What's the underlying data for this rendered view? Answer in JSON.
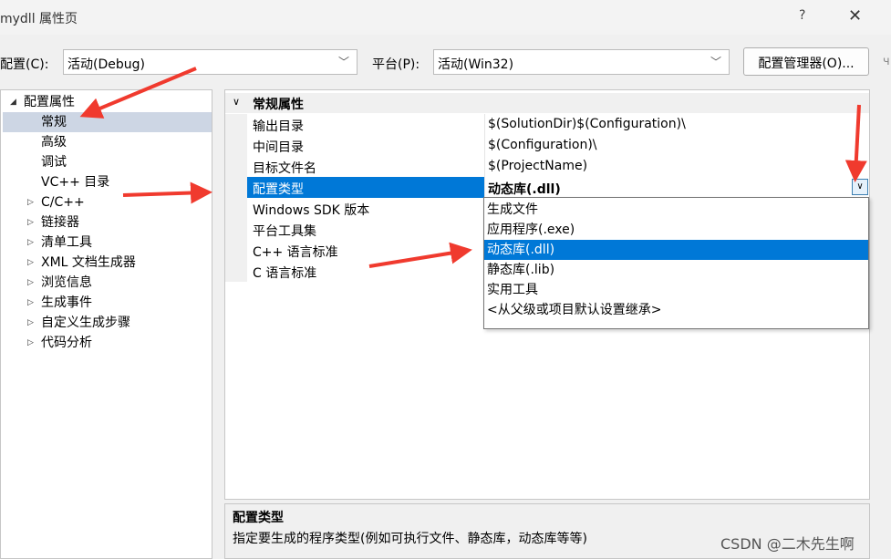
{
  "window": {
    "title": "mydll 属性页",
    "help_label": "?",
    "close_label": "✕",
    "edge_char": "ч"
  },
  "toolbar": {
    "config_label": "配置(C):",
    "config_value": "活动(Debug)",
    "platform_label": "平台(P):",
    "platform_value": "活动(Win32)",
    "manager_button": "配置管理器(O)..."
  },
  "tree": {
    "items": [
      {
        "label": "配置属性",
        "expander": "◢"
      },
      {
        "label": "常规",
        "expander": ""
      },
      {
        "label": "高级",
        "expander": ""
      },
      {
        "label": "调试",
        "expander": ""
      },
      {
        "label": "VC++ 目录",
        "expander": ""
      },
      {
        "label": "C/C++",
        "expander": "▷"
      },
      {
        "label": "链接器",
        "expander": "▷"
      },
      {
        "label": "清单工具",
        "expander": "▷"
      },
      {
        "label": "XML 文档生成器",
        "expander": "▷"
      },
      {
        "label": "浏览信息",
        "expander": "▷"
      },
      {
        "label": "生成事件",
        "expander": "▷"
      },
      {
        "label": "自定义生成步骤",
        "expander": "▷"
      },
      {
        "label": "代码分析",
        "expander": "▷"
      }
    ]
  },
  "grid": {
    "category": "常规属性",
    "category_expander": "∨",
    "rows": [
      {
        "name": "输出目录",
        "value": "$(SolutionDir)$(Configuration)\\"
      },
      {
        "name": "中间目录",
        "value": "$(Configuration)\\"
      },
      {
        "name": "目标文件名",
        "value": "$(ProjectName)"
      },
      {
        "name": "配置类型",
        "value": "动态库(.dll)"
      },
      {
        "name": "Windows SDK 版本",
        "value": ""
      },
      {
        "name": "平台工具集",
        "value": ""
      },
      {
        "name": "C++ 语言标准",
        "value": ""
      },
      {
        "name": "C 语言标准",
        "value": ""
      }
    ]
  },
  "dropdown": {
    "options": [
      "生成文件",
      "应用程序(.exe)",
      "动态库(.dll)",
      "静态库(.lib)",
      "实用工具",
      "<从父级或项目默认设置继承>"
    ],
    "selected": "动态库(.dll)"
  },
  "description": {
    "heading": "配置类型",
    "text": "指定要生成的程序类型(例如可执行文件、静态库，动态库等等)"
  },
  "watermark": "CSDN @二木先生啊",
  "colors": {
    "selection": "#0078d7",
    "annotation_arrow": "#f03a2e",
    "tree_selection": "#cdd6e4"
  }
}
